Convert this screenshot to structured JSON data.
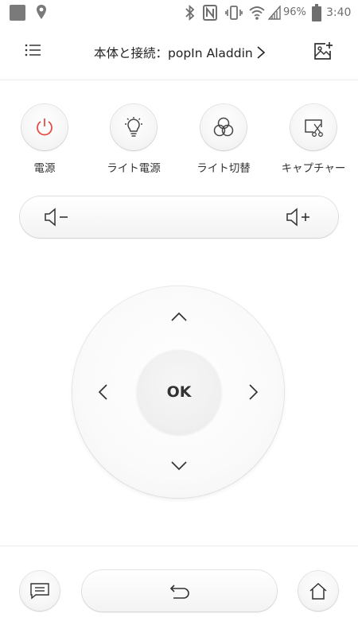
{
  "status_bar": {
    "battery_percent": "96%",
    "time": "3:40",
    "icons": [
      "app-square-icon",
      "location-icon",
      "bluetooth-icon",
      "nfc-icon",
      "vibrate-icon",
      "wifi-icon",
      "signal-icon",
      "battery-icon"
    ]
  },
  "header": {
    "title": "本体と接続：popIn Aladdin",
    "menu_icon": "menu-icon",
    "image_icon": "add-image-icon"
  },
  "quick_actions": [
    {
      "label": "電源",
      "icon": "power-icon",
      "color": "#e05045"
    },
    {
      "label": "ライト電源",
      "icon": "bulb-icon",
      "color": "#444444"
    },
    {
      "label": "ライト切替",
      "icon": "light-switch-icon",
      "color": "#444444"
    },
    {
      "label": "キャプチャー",
      "icon": "capture-icon",
      "color": "#444444"
    }
  ],
  "volume": {
    "down_icon": "volume-down-icon",
    "up_icon": "volume-up-icon"
  },
  "dpad": {
    "ok_label": "OK"
  },
  "bottom": {
    "menu_icon": "list-icon",
    "back_icon": "back-icon",
    "home_icon": "home-icon"
  }
}
